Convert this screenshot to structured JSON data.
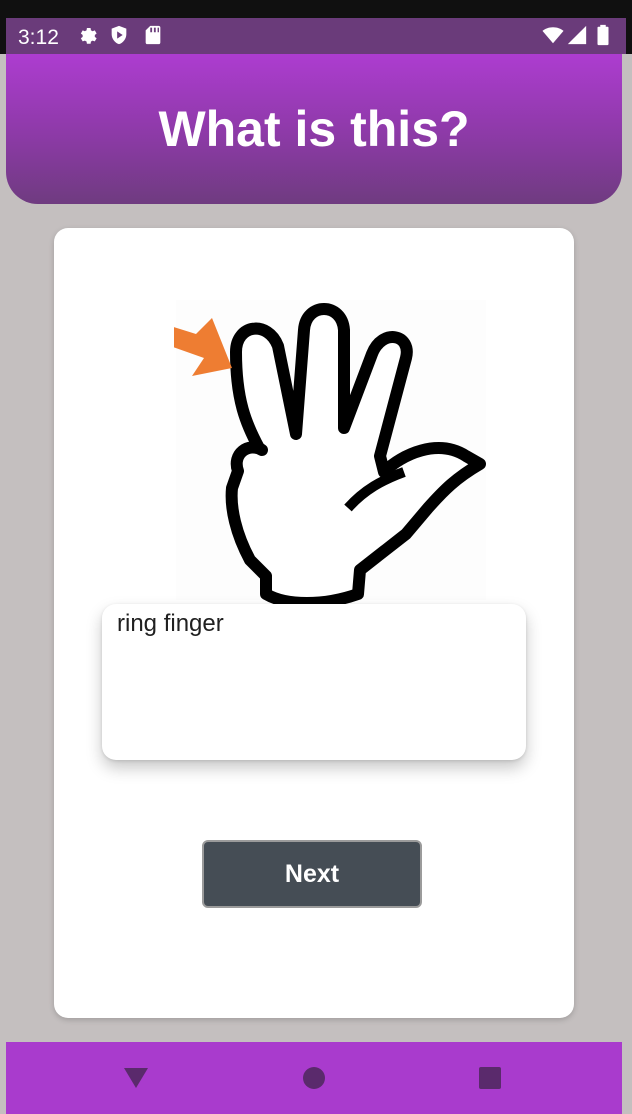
{
  "status_bar": {
    "time": "3:12",
    "icons_left": [
      "gear-icon",
      "shield-icon",
      "sd-card-icon"
    ],
    "icons_right": [
      "wifi-icon",
      "signal-icon",
      "battery-icon"
    ]
  },
  "header": {
    "title": "What is this?"
  },
  "quiz": {
    "image_name": "hand-with-arrow-illustration",
    "answer_text": "ring finger",
    "next_label": "Next"
  },
  "nav_bar": {
    "buttons": [
      "back-triangle-icon",
      "home-circle-icon",
      "recents-square-icon"
    ]
  },
  "colors": {
    "header_top": "#ad3cd0",
    "header_bottom": "#6f3b80",
    "background": "#c4bfbf",
    "button": "#454d55",
    "arrow": "#ee7d32",
    "nav_bar": "#a93bcd"
  }
}
